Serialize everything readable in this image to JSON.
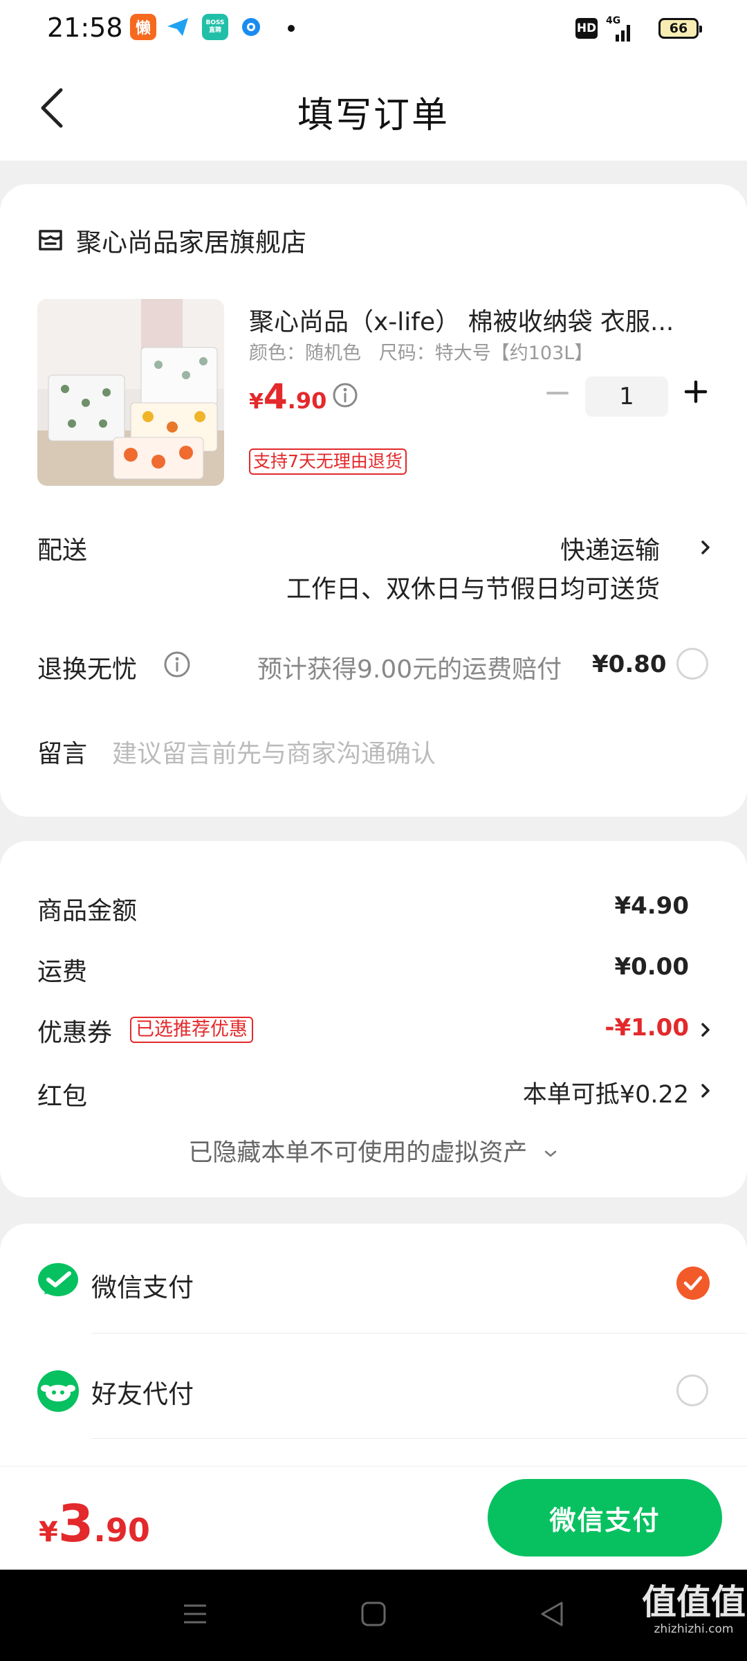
{
  "status_bar": {
    "time": "21:58",
    "apps": [
      {
        "name": "lazy-app-icon",
        "text": "懒",
        "color": "#f56a1f"
      },
      {
        "name": "paper-plane-icon",
        "text": "",
        "color": "#1fa2f1"
      },
      {
        "name": "boss-app-icon",
        "text": "BOSS",
        "color": "#21bfa8"
      },
      {
        "name": "circle-app-icon",
        "text": "",
        "color": "#1a8cf0"
      }
    ],
    "hd": "HD",
    "network": "4G",
    "battery": "66"
  },
  "header": {
    "title": "填写订单"
  },
  "store": {
    "name": "聚心尚品家居旗舰店"
  },
  "product": {
    "title": "聚心尚品（x-life） 棉被收纳袋 衣服...",
    "spec": "颜色：随机色   尺码：特大号【约103L】",
    "price_symbol": "¥",
    "price_int": "4",
    "price_dec": ".90",
    "quantity": "1",
    "return_tag": "支持7天无理由退货"
  },
  "delivery": {
    "label": "配送",
    "method": "快递运输",
    "note": "工作日、双休日与节假日均可送货"
  },
  "worry_free": {
    "label": "退换无忧",
    "desc": "预计获得9.00元的运费赔付",
    "price": "¥0.80"
  },
  "message": {
    "label": "留言",
    "placeholder": "建议留言前先与商家沟通确认"
  },
  "summary": {
    "goods_label": "商品金额",
    "goods_value": "¥4.90",
    "shipping_label": "运费",
    "shipping_value": "¥0.00",
    "coupon_label": "优惠券",
    "coupon_tag": "已选推荐优惠",
    "coupon_value": "-¥1.00",
    "redpacket_label": "红包",
    "redpacket_value": "本单可抵¥0.22",
    "hidden_note": "已隐藏本单不可使用的虚拟资产"
  },
  "payment": {
    "options": [
      {
        "label": "微信支付",
        "selected": true
      },
      {
        "label": "好友代付",
        "selected": false
      }
    ]
  },
  "bottom": {
    "total_symbol": "¥",
    "total_int": "3",
    "total_dec": ".90",
    "pay_button": "微信支付"
  },
  "watermark": {
    "text": "值值值",
    "url": "zhizhizhi.com"
  },
  "colors": {
    "accent": "#07c160",
    "price_red": "#e3292b",
    "selected_orange": "#f25a2a"
  }
}
